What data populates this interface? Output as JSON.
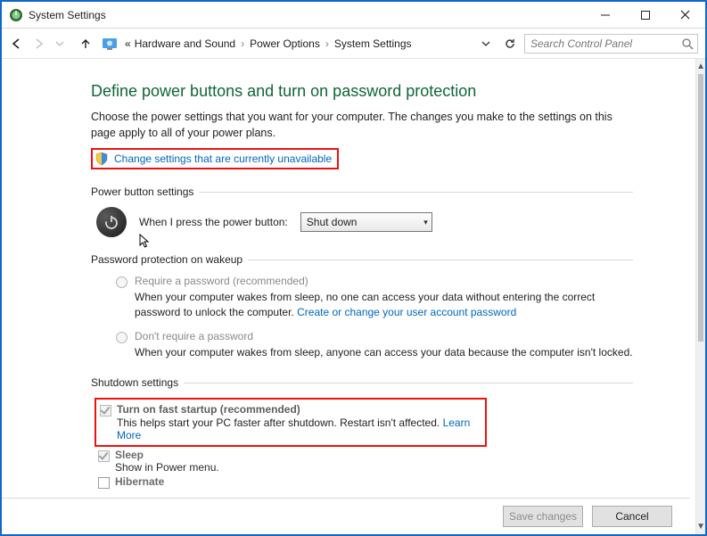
{
  "window": {
    "title": "System Settings"
  },
  "breadcrumbs": {
    "part1": "Hardware and Sound",
    "part2": "Power Options",
    "part3": "System Settings"
  },
  "search": {
    "placeholder": "Search Control Panel"
  },
  "heading": "Define power buttons and turn on password protection",
  "description": "Choose the power settings that you want for your computer. The changes you make to the settings on this page apply to all of your power plans.",
  "change_link": "Change settings that are currently unavailable",
  "sections": {
    "power_button": "Power button settings",
    "password": "Password protection on wakeup",
    "shutdown": "Shutdown settings"
  },
  "power_button": {
    "label": "When I press the power button:",
    "value": "Shut down"
  },
  "password_opts": {
    "require": {
      "label": "Require a password (recommended)",
      "desc_pre": "When your computer wakes from sleep, no one can access your data without entering the correct password to unlock the computer. ",
      "link": "Create or change your user account password"
    },
    "dont": {
      "label": "Don't require a password",
      "desc": "When your computer wakes from sleep, anyone can access your data because the computer isn't locked."
    }
  },
  "shutdown_opts": {
    "fast": {
      "label": "Turn on fast startup (recommended)",
      "desc_pre": "This helps start your PC faster after shutdown. Restart isn't affected. ",
      "link": "Learn More"
    },
    "sleep": {
      "label": "Sleep",
      "desc": "Show in Power menu."
    },
    "hibernate": {
      "label": "Hibernate"
    }
  },
  "footer": {
    "save": "Save changes",
    "cancel": "Cancel"
  }
}
